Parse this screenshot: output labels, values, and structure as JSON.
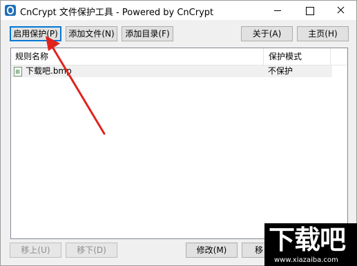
{
  "window": {
    "title": "CnCrypt 文件保护工具 - Powered by CnCrypt"
  },
  "toolbar": {
    "enable_protect": "启用保护(P)",
    "add_file": "添加文件(N)",
    "add_dir": "添加目录(F)",
    "about": "关于(A)",
    "home": "主页(H)"
  },
  "list": {
    "columns": [
      "规则名称",
      "保护模式"
    ],
    "rows": [
      {
        "name": "下载吧.bmp",
        "mode": "不保护"
      }
    ]
  },
  "bottom": {
    "move_up": "移上(U)",
    "move_down": "移下(D)",
    "modify": "修改(M)",
    "remove_partial": "移"
  },
  "watermark": {
    "text": "下载吧",
    "url": "www.xiazaiba.com"
  },
  "colors": {
    "annotation_arrow": "#e0231e",
    "focus_border": "#0078d7"
  }
}
